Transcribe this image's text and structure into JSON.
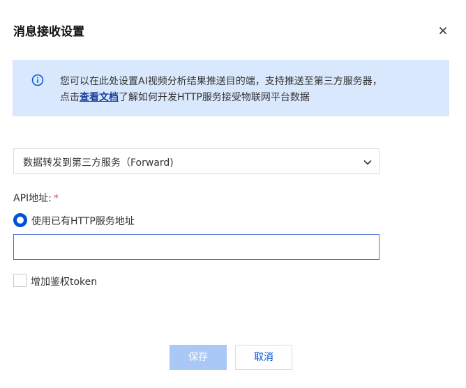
{
  "dialog": {
    "title": "消息接收设置",
    "close_icon": "close-icon"
  },
  "notice": {
    "icon": "info-icon",
    "line1": "您可以在此处设置AI视频分析结果推送目的端，支持推送至第三方服务器，",
    "line2_prefix": "点击",
    "doc_link": "查看文档",
    "line2_suffix": "了解如何开发HTTP服务接受物联网平台数据",
    "background_color": "#d9e8fc"
  },
  "forward_select": {
    "value": "数据转发到第三方服务（Forward)",
    "icon": "chevron-down-icon"
  },
  "api": {
    "label": "API地址:",
    "required_mark": "*"
  },
  "http_option": {
    "label": "使用已有HTTP服务地址",
    "selected": true
  },
  "url_input": {
    "value": "",
    "placeholder": ""
  },
  "token_option": {
    "label": "增加鉴权token",
    "checked": false
  },
  "buttons": {
    "save": "保存",
    "cancel": "取消"
  },
  "colors": {
    "primary": "#0052d9",
    "save_disabled": "#aac8f7",
    "required": "#e54545"
  }
}
